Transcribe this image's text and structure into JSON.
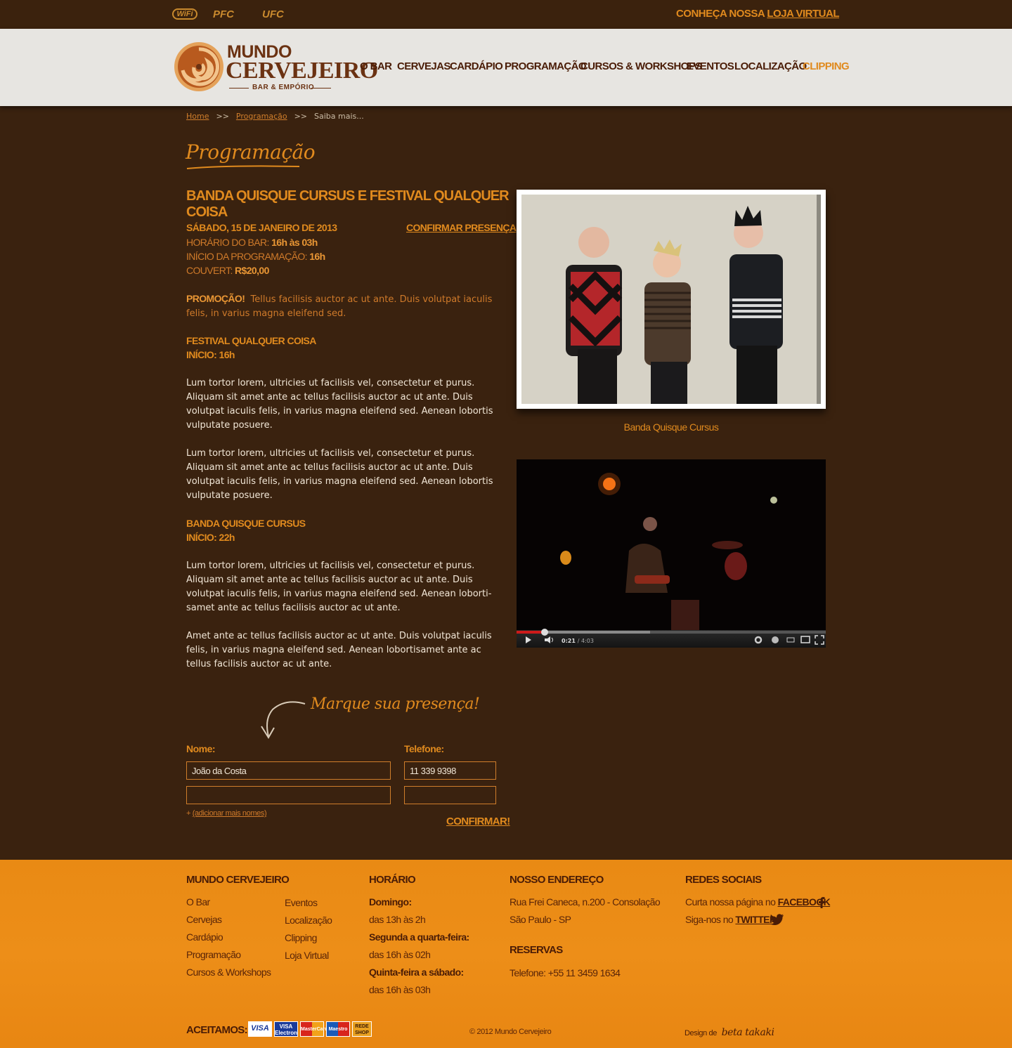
{
  "topbar": {
    "icons": [
      "WiFi",
      "PFC",
      "UFC"
    ],
    "store_prefix": "CONHEÇA NOSSA",
    "store_link": "LOJA VIRTUAL"
  },
  "logo": {
    "line1": "MUNDO",
    "line2": "CERVEJEIRO",
    "line3": "BAR & EMPÓRIO"
  },
  "nav": {
    "items": [
      "O BAR",
      "CERVEJAS",
      "CARDÁPIO",
      "PROGRAMAÇÃO",
      "CURSOS & WORKSHOPS",
      "EVENTOS",
      "LOCALIZAÇÃO",
      "CLIPPING"
    ],
    "active": "CLIPPING"
  },
  "breadcrumb": {
    "home": "Home",
    "section": "Programação",
    "current": "Saiba mais...",
    "separator": ">>"
  },
  "section_title": "Programação",
  "event": {
    "title": "BANDA  QUISQUE CURSUS E FESTIVAL QUALQUER COISA",
    "date": "SÁBADO, 15 DE JANEIRO DE 2013",
    "confirm_link": "CONFIRMAR PRESENÇA",
    "bar_hours_label": "HORÁRIO DO BAR:",
    "bar_hours_value": "16h às 03h",
    "program_start_label": "INÍCIO DA PROGRAMAÇÃO:",
    "program_start_value": "16h",
    "couvert_label": "COUVERT:",
    "couvert_value": "R$20,00",
    "promo_label": "PROMOÇÃO!",
    "promo_text": "Tellus facilisis auctor ac ut ante. Duis volutpat iaculis felis, in varius magna eleifend sed.",
    "festival_head": "FESTIVAL QUALQUER COISA",
    "festival_start": "INÍCIO: 16h",
    "para1": "Lum tortor lorem, ultricies ut facilisis vel, consectetur et purus. Aliquam sit amet ante ac tellus facilisis auctor ac ut ante. Duis volutpat iaculis felis, in varius magna eleifend sed. Aenean lobortis vulputate posuere.",
    "para2": "Lum tortor lorem, ultricies ut facilisis vel, consectetur et purus. Aliquam sit amet ante ac tellus facilisis auctor ac ut ante. Duis volutpat iaculis felis, in varius magna eleifend sed. Aenean lobortis vulputate posuere.",
    "band_head": "BANDA QUISQUE CURSUS",
    "band_start": "INÍCIO: 22h",
    "para3": "Lum tortor lorem, ultricies ut facilisis vel, consectetur et purus. Aliquam sit amet ante ac tellus facilisis auctor ac ut ante. Duis volutpat iaculis felis, in varius magna eleifend sed. Aenean loborti-samet ante ac tellus facilisis auctor ac ut ante.",
    "para4": "Amet ante ac tellus facilisis auctor ac ut ante. Duis volutpat iaculis felis, in varius magna eleifend sed. Aenean lobortisamet ante ac tellus facilisis auctor ac ut ante."
  },
  "photo": {
    "caption": "Banda  Quisque Cursus"
  },
  "video": {
    "time_current": "0:21",
    "time_total": "/ 4:03",
    "progress": 0.09
  },
  "presence_form": {
    "title": "Marque sua presença!",
    "name_label": "Nome:",
    "phone_label": "Telefone:",
    "name_value": "João da Costa",
    "phone_value": "11 339 9398",
    "add_names_prefix": "+",
    "add_names": "(adicionar mais nomes)",
    "confirm": "CONFIRMAR!"
  },
  "footer": {
    "col1_head": "MUNDO CERVEJEIRO",
    "col1_links_a": [
      "O Bar",
      "Cervejas",
      "Cardápio",
      "Programação",
      "Cursos & Workshops"
    ],
    "col1_links_b": [
      "Eventos",
      "Localização",
      "Clipping",
      "Loja Virtual"
    ],
    "col2_head": "HORÁRIO",
    "hours": [
      {
        "day": "Domingo:",
        "time": "das 13h às 2h"
      },
      {
        "day": "Segunda a quarta-feira:",
        "time": "das 16h às 02h"
      },
      {
        "day": "Quinta-feira a sábado:",
        "time": "das 16h às 03h"
      }
    ],
    "col3_head": "NOSSO ENDEREÇO",
    "address1": "Rua Frei Caneca, n.200 - Consolação",
    "address2": "São Paulo - SP",
    "reservas_head": "RESERVAS",
    "phone": "Telefone: +55 11 3459 1634",
    "col4_head": "REDES SOCIAIS",
    "facebook_prefix": "Curta nossa página no",
    "facebook": "FACEBOOK",
    "twitter_prefix": "Siga-nos no",
    "twitter": "TWITTER",
    "accept_label": "ACEITAMOS:",
    "cards": [
      "VISA",
      "VISA Electron",
      "MasterCard",
      "Maestro",
      "REDE SHOP"
    ],
    "copyright": "© 2012 Mundo Cervejeiro",
    "design_prefix": "Design de",
    "designer": "beta takaki"
  },
  "colors": {
    "accent": "#e08a1e",
    "brown_dark": "#3a220f",
    "footer": "#ed8e18",
    "nav_text": "#4a1c06"
  }
}
